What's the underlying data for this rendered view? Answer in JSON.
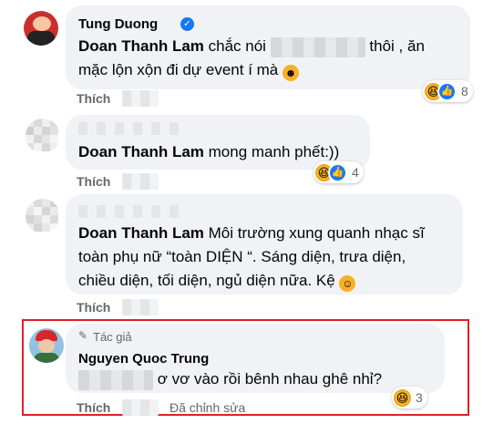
{
  "comments": [
    {
      "author": "Tung Duong",
      "mention": "Doan Thanh Lam",
      "text_before_blur": " chắc nói",
      "text_after_blur": " thôi , ăn",
      "text_line2": "mặc lộn xộn đi dự event í mà",
      "emoji": "😄",
      "action": "Thích",
      "reaction_count": "8",
      "verified_icon": "verified-badge-icon"
    },
    {
      "mention": "Doan Thanh Lam",
      "text": " mong manh phết:))",
      "action": "Thích",
      "reaction_count": "4"
    },
    {
      "mention": "Doan Thanh Lam",
      "text_line1": " Môi trường xung quanh nhạc sĩ",
      "text_line2": "toàn phụ nữ “toàn DIỆN “. Sáng diện, trưa diện,",
      "text_line3": "chiều diện, tối diện, ngủ diện nữa. Kệ",
      "emoji": "☺️",
      "action": "Thích"
    },
    {
      "author_tag": "Tác giả",
      "author": "Nguyen Quoc Trung",
      "text": " ơ vơ vào rồi bênh nhau ghê nhỉ?",
      "action": "Thích",
      "edited": "Đã chỉnh sửa",
      "reaction_count": "3"
    }
  ],
  "colors": {
    "bubble": "#f0f2f5",
    "secondary_text": "#65676b",
    "highlight_border": "#e21f26",
    "like_blue": "#1877f2"
  }
}
